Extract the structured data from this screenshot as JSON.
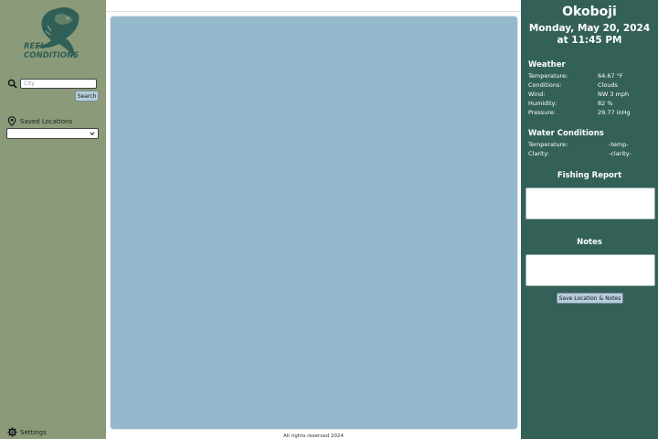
{
  "sidebar": {
    "logo_text_line1": "REEL",
    "logo_text_line2": "CONDITIONS",
    "city_placeholder": "City",
    "search_label": "Search",
    "saved_label": "Saved Locations",
    "saved_select_value": "",
    "settings_label": "Settings"
  },
  "footer": {
    "text": "All rights reserved 2024"
  },
  "panel": {
    "location": "Okoboji",
    "datetime": "Monday, May 20, 2024 at 11:45 PM",
    "weather": {
      "heading": "Weather",
      "rows": [
        {
          "label": "Temperature:",
          "value": "64.67 °F"
        },
        {
          "label": "Conditions:",
          "value": "Clouds"
        },
        {
          "label": "Wind:",
          "value": "NW 3 mph"
        },
        {
          "label": "Humidity:",
          "value": "82 %"
        },
        {
          "label": "Pressure:",
          "value": "29.77 inHg"
        }
      ]
    },
    "water": {
      "heading": "Water Conditions",
      "rows": [
        {
          "label": "Temperature:",
          "value": "-temp-"
        },
        {
          "label": "Clarity:",
          "value": "-clarity-"
        }
      ]
    },
    "fishing_report_heading": "Fishing Report",
    "notes_heading": "Notes",
    "save_button": "Save Location & Notes"
  },
  "colors": {
    "sidebar_bg": "#8b9a78",
    "panel_bg": "#336157",
    "map_bg": "#94b9cd",
    "button_bg": "#b7cfdc",
    "logo_color": "#2f5f57"
  },
  "icons": [
    "fish-logo-icon",
    "search-icon",
    "location-pin-icon",
    "chevron-down-icon",
    "gear-icon"
  ]
}
